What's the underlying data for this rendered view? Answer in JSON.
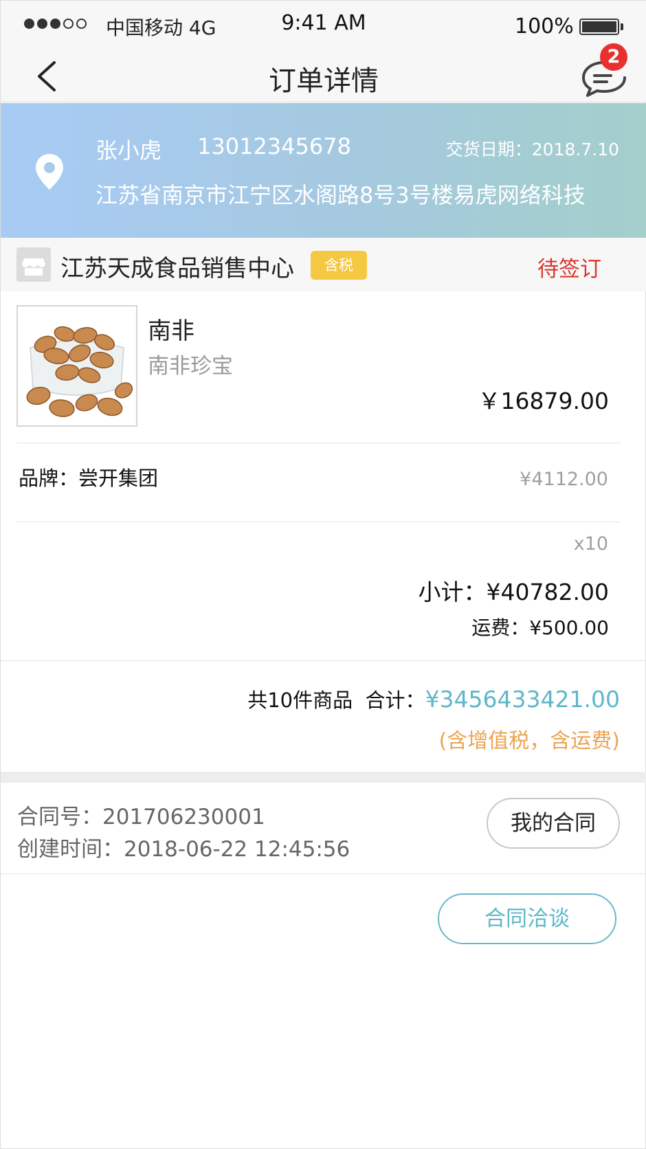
{
  "status_bar": {
    "carrier": "中国移动 4G",
    "time": "9:41 AM",
    "battery": "100%",
    "signal_icon": "signal-dots-icon",
    "battery_icon": "battery-icon"
  },
  "nav": {
    "title": "订单详情",
    "back_icon": "chevron-left-icon",
    "message_icon": "chat-bubble-icon",
    "unread_count": "2"
  },
  "address": {
    "icon": "location-pin-icon",
    "name": "张小虎",
    "phone": "13012345678",
    "delivery_date": "交货日期：2018.7.10",
    "full_address": "江苏省南京市江宁区水阁路8号3号楼易虎网络科技"
  },
  "store": {
    "icon": "store-icon",
    "name": "江苏天成食品销售中心",
    "tax_tag": "含税",
    "order_status": "待签订"
  },
  "product": {
    "image": "pecan-nuts-photo",
    "name": "南非",
    "subtitle": "南非珍宝",
    "price": "￥16879.00",
    "brand": "品牌：尝开集团",
    "unit_price": "¥4112.00",
    "quantity": "x10",
    "subtotal": "小计：¥40782.00",
    "freight": "运费：¥500.00"
  },
  "totals": {
    "summary": "共10件商品  合计：",
    "amount": "¥3456433421.00",
    "note": "(含增值税，含运费)"
  },
  "contract": {
    "number": "合同号：201706230001",
    "created": "创建时间：2018-06-22 12:45:56",
    "my_contract_button": "我的合同",
    "negotiate_button": "合同洽谈"
  },
  "colors": {
    "status_red": "#d8362d",
    "accent_teal": "#5eb7c9",
    "note_orange": "#eba452",
    "tax_tag_yellow": "#f5c842",
    "badge_red": "#e8312f"
  }
}
